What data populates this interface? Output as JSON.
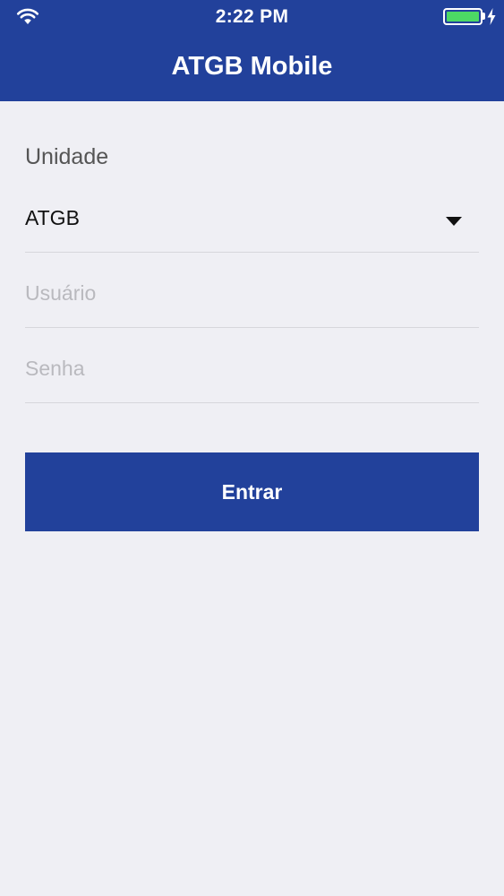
{
  "status_bar": {
    "time": "2:22 PM",
    "wifi_icon": "wifi-icon",
    "battery_icon": "battery-icon",
    "charging_icon": "bolt-icon",
    "battery_color": "#4cd964"
  },
  "header": {
    "title": "ATGB Mobile",
    "background_color": "#22419b"
  },
  "form": {
    "unit_label": "Unidade",
    "unit_value": "ATGB",
    "unit_caret_icon": "caret-down-icon",
    "username": {
      "value": "",
      "placeholder": "Usuário"
    },
    "password": {
      "value": "",
      "placeholder": "Senha"
    },
    "submit_label": "Entrar"
  }
}
